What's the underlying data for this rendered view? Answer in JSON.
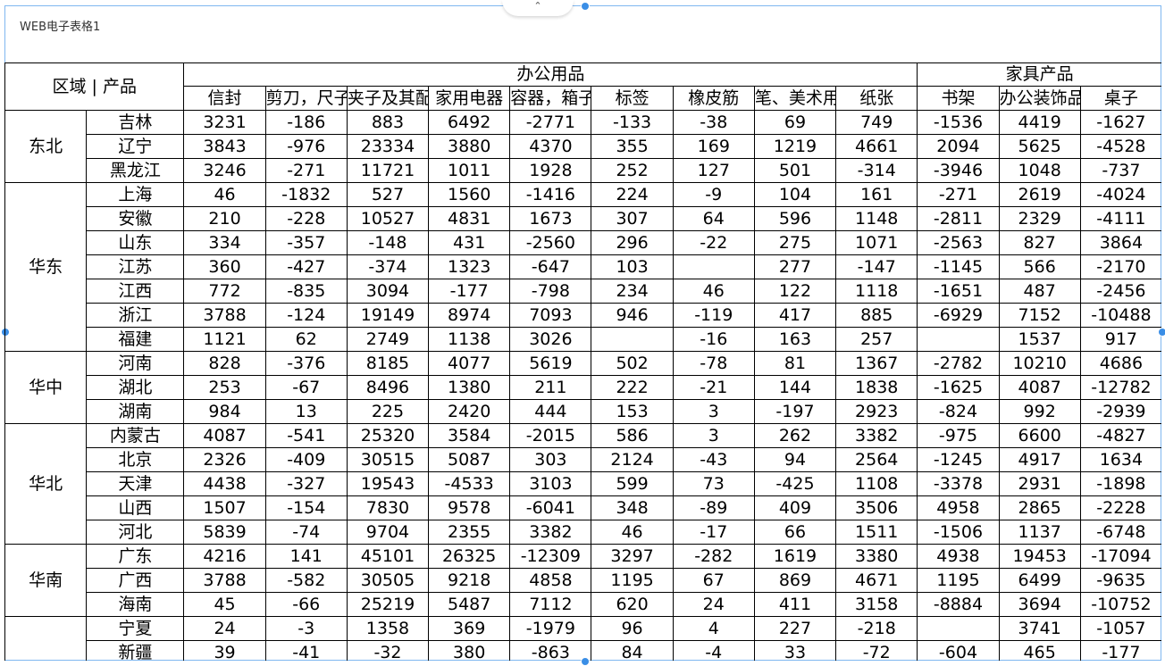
{
  "report_title": "WEB电子表格1",
  "toggle_icon": "chevron-up-icon",
  "corner_label": "区域 | 产品",
  "groups": [
    {
      "label": "办公用品",
      "columns": [
        "信封",
        "剪刀，尺子",
        "夹子及其配件",
        "家用电器",
        "容器，箱子",
        "标签",
        "橡皮筋",
        "笔、美术用品",
        "纸张"
      ]
    },
    {
      "label": "家具产品",
      "columns": [
        "书架",
        "办公装饰品",
        "桌子"
      ]
    }
  ],
  "regions": [
    {
      "name": "东北",
      "rows": [
        {
          "province": "吉林",
          "values": [
            "3231",
            "-186",
            "883",
            "6492",
            "-2771",
            "-133",
            "-38",
            "69",
            "749",
            "-1536",
            "4419",
            "-1627"
          ]
        },
        {
          "province": "辽宁",
          "values": [
            "3843",
            "-976",
            "23334",
            "3880",
            "4370",
            "355",
            "169",
            "1219",
            "4661",
            "2094",
            "5625",
            "-4528"
          ]
        },
        {
          "province": "黑龙江",
          "values": [
            "3246",
            "-271",
            "11721",
            "1011",
            "1928",
            "252",
            "127",
            "501",
            "-314",
            "-3946",
            "1048",
            "-737"
          ]
        }
      ]
    },
    {
      "name": "华东",
      "rows": [
        {
          "province": "上海",
          "values": [
            "46",
            "-1832",
            "527",
            "1560",
            "-1416",
            "224",
            "-9",
            "104",
            "161",
            "-271",
            "2619",
            "-4024"
          ]
        },
        {
          "province": "安徽",
          "values": [
            "210",
            "-228",
            "10527",
            "4831",
            "1673",
            "307",
            "64",
            "596",
            "1148",
            "-2811",
            "2329",
            "-4111"
          ]
        },
        {
          "province": "山东",
          "values": [
            "334",
            "-357",
            "-148",
            "431",
            "-2560",
            "296",
            "-22",
            "275",
            "1071",
            "-2563",
            "827",
            "3864"
          ]
        },
        {
          "province": "江苏",
          "values": [
            "360",
            "-427",
            "-374",
            "1323",
            "-647",
            "103",
            "",
            "277",
            "-147",
            "-1145",
            "566",
            "-2170"
          ]
        },
        {
          "province": "江西",
          "values": [
            "772",
            "-835",
            "3094",
            "-177",
            "-798",
            "234",
            "46",
            "122",
            "1118",
            "-1651",
            "487",
            "-2456"
          ]
        },
        {
          "province": "浙江",
          "values": [
            "3788",
            "-124",
            "19149",
            "8974",
            "7093",
            "946",
            "-119",
            "417",
            "885",
            "-6929",
            "7152",
            "-10488"
          ]
        },
        {
          "province": "福建",
          "values": [
            "1121",
            "62",
            "2749",
            "1138",
            "3026",
            "",
            "-16",
            "163",
            "257",
            "",
            "1537",
            "917"
          ]
        }
      ]
    },
    {
      "name": "华中",
      "rows": [
        {
          "province": "河南",
          "values": [
            "828",
            "-376",
            "8185",
            "4077",
            "5619",
            "502",
            "-78",
            "81",
            "1367",
            "-2782",
            "10210",
            "4686"
          ]
        },
        {
          "province": "湖北",
          "values": [
            "253",
            "-67",
            "8496",
            "1380",
            "211",
            "222",
            "-21",
            "144",
            "1838",
            "-1625",
            "4087",
            "-12782"
          ]
        },
        {
          "province": "湖南",
          "values": [
            "984",
            "13",
            "225",
            "2420",
            "444",
            "153",
            "3",
            "-197",
            "2923",
            "-824",
            "992",
            "-2939"
          ]
        }
      ]
    },
    {
      "name": "华北",
      "rows": [
        {
          "province": "内蒙古",
          "values": [
            "4087",
            "-541",
            "25320",
            "3584",
            "-2015",
            "586",
            "3",
            "262",
            "3382",
            "-975",
            "6600",
            "-4827"
          ]
        },
        {
          "province": "北京",
          "values": [
            "2326",
            "-409",
            "30515",
            "5087",
            "303",
            "2124",
            "-43",
            "94",
            "2564",
            "-1245",
            "4917",
            "1634"
          ]
        },
        {
          "province": "天津",
          "values": [
            "4438",
            "-327",
            "19543",
            "-4533",
            "3103",
            "599",
            "73",
            "-425",
            "1108",
            "-3378",
            "2931",
            "-1898"
          ]
        },
        {
          "province": "山西",
          "values": [
            "1507",
            "-154",
            "7830",
            "9578",
            "-6041",
            "348",
            "-89",
            "409",
            "3506",
            "4958",
            "2865",
            "-2228"
          ]
        },
        {
          "province": "河北",
          "values": [
            "5839",
            "-74",
            "9704",
            "2355",
            "3382",
            "46",
            "-17",
            "66",
            "1511",
            "-1506",
            "1137",
            "-6748"
          ]
        }
      ]
    },
    {
      "name": "华南",
      "rows": [
        {
          "province": "广东",
          "values": [
            "4216",
            "141",
            "45101",
            "26325",
            "-12309",
            "3297",
            "-282",
            "1619",
            "3380",
            "4938",
            "19453",
            "-17094"
          ]
        },
        {
          "province": "广西",
          "values": [
            "3788",
            "-582",
            "30505",
            "9218",
            "4858",
            "1195",
            "67",
            "869",
            "4671",
            "1195",
            "6499",
            "-9635"
          ]
        },
        {
          "province": "海南",
          "values": [
            "45",
            "-66",
            "25219",
            "5487",
            "7112",
            "620",
            "24",
            "411",
            "3158",
            "-8884",
            "3694",
            "-10752"
          ]
        }
      ]
    },
    {
      "name": "",
      "rows": [
        {
          "province": "宁夏",
          "values": [
            "24",
            "-3",
            "1358",
            "369",
            "-1979",
            "96",
            "4",
            "227",
            "-218",
            "",
            "3741",
            "-1057"
          ]
        },
        {
          "province": "新疆",
          "values": [
            "39",
            "-41",
            "-32",
            "380",
            "-863",
            "84",
            "-4",
            "33",
            "-72",
            "-604",
            "465",
            "-177"
          ]
        }
      ]
    }
  ]
}
